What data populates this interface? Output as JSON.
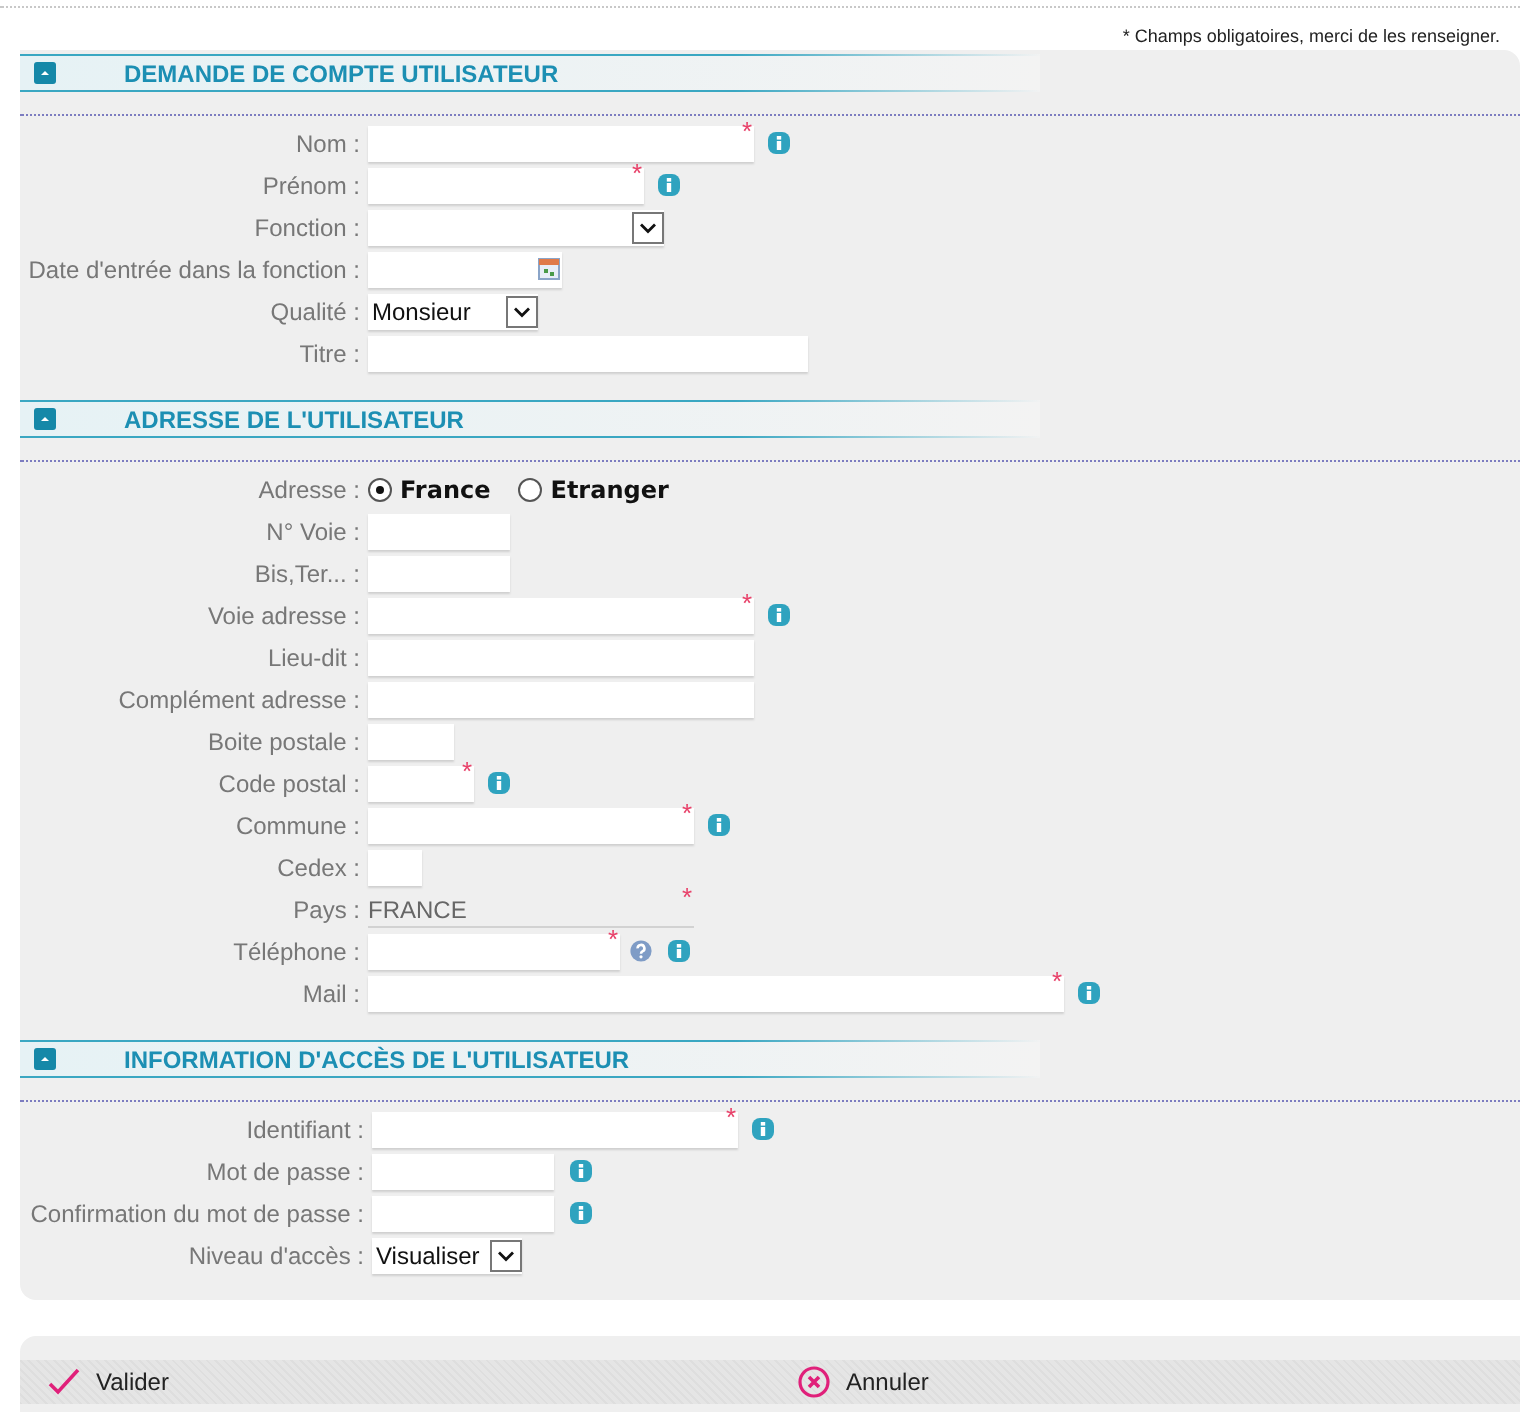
{
  "note": "* Champs obligatoires, merci de les renseigner.",
  "sections": [
    {
      "title": "DEMANDE DE COMPTE UTILISATEUR",
      "expanded": true,
      "fields": [
        {
          "label": "Nom :",
          "kind": "text",
          "asterisk": "*",
          "info": true
        },
        {
          "label": "Prénom :",
          "kind": "text",
          "asterisk": "*",
          "info": true
        },
        {
          "label": "Fonction :",
          "kind": "select"
        },
        {
          "label": "Date d'entrée dans la fonction :",
          "kind": "date"
        },
        {
          "label": "Qualité :",
          "kind": "select",
          "value": "Monsieur"
        },
        {
          "label": "Titre :",
          "kind": "text"
        }
      ]
    },
    {
      "title": "ADRESSE DE L'UTILISATEUR",
      "expanded": true,
      "fields": [
        {
          "label": "Adresse :",
          "kind": "radio",
          "options": [
            {
              "label": "France",
              "selected": true
            },
            {
              "label": "Etranger",
              "selected": false
            }
          ]
        },
        {
          "label": "N° Voie :",
          "kind": "text"
        },
        {
          "label": "Bis,Ter... :",
          "kind": "text"
        },
        {
          "label": "Voie adresse :",
          "kind": "text",
          "asterisk": "*",
          "info": true
        },
        {
          "label": "Lieu-dit :",
          "kind": "text"
        },
        {
          "label": "Complément adresse :",
          "kind": "text"
        },
        {
          "label": "Boite postale :",
          "kind": "text"
        },
        {
          "label": "Code postal :",
          "kind": "text",
          "asterisk": "*",
          "info": true
        },
        {
          "label": "Commune :",
          "kind": "text",
          "asterisk": "*",
          "info": true
        },
        {
          "label": "Cedex :",
          "kind": "text"
        },
        {
          "label": "Pays :",
          "kind": "static",
          "value": "FRANCE",
          "asterisk": "*"
        },
        {
          "label": "Téléphone :",
          "kind": "text",
          "asterisk": "*",
          "help": true,
          "info": true
        },
        {
          "label": "Mail :",
          "kind": "text",
          "asterisk": "*",
          "info": true
        }
      ]
    },
    {
      "title": "INFORMATION D'ACCÈS DE L'UTILISATEUR",
      "expanded": true,
      "fields": [
        {
          "label": "Identifiant :",
          "kind": "text",
          "asterisk": "*",
          "info": true
        },
        {
          "label": "Mot de passe :",
          "kind": "text",
          "info": true
        },
        {
          "label": "Confirmation du mot de passe :",
          "kind": "text",
          "info": true
        },
        {
          "label": "Niveau d'accès :",
          "kind": "select",
          "value": "Visualiser"
        }
      ]
    }
  ],
  "actions": [
    {
      "label": "Valider",
      "kind": "confirm"
    },
    {
      "label": "Annuler",
      "kind": "cancel"
    }
  ]
}
